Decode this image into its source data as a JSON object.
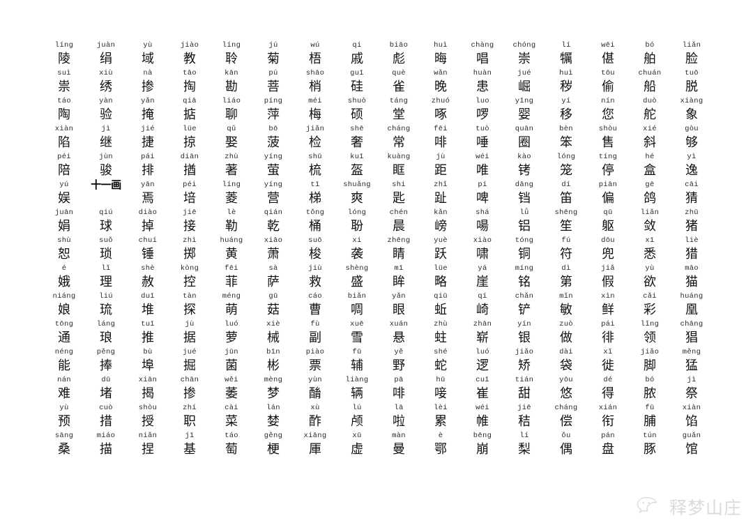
{
  "page": {
    "title": "汉字拼音表",
    "background_color": "#ffffff",
    "text_color": "#111111",
    "pinyin_color": "#2b2b2b"
  },
  "section_header": {
    "label": "十一画",
    "row_index": 6,
    "col_index": 1
  },
  "watermark": {
    "icon": "wechat-icon",
    "text": "释梦山庄",
    "color": "#b9b9b9"
  },
  "grid": {
    "columns": 16,
    "rows": 18,
    "cells": [
      [
        {
          "pinyin": "líng",
          "hanzi": "陵"
        },
        {
          "pinyin": "juàn",
          "hanzi": "绢"
        },
        {
          "pinyin": "yù",
          "hanzi": "域"
        },
        {
          "pinyin": "jiào",
          "hanzi": "教"
        },
        {
          "pinyin": "líng",
          "hanzi": "聆"
        },
        {
          "pinyin": "jú",
          "hanzi": "菊"
        },
        {
          "pinyin": "wú",
          "hanzi": "梧"
        },
        {
          "pinyin": "qi",
          "hanzi": "戚"
        },
        {
          "pinyin": "biāo",
          "hanzi": "彪"
        },
        {
          "pinyin": "huì",
          "hanzi": "晦"
        },
        {
          "pinyin": "chàng",
          "hanzi": "唱"
        },
        {
          "pinyin": "chóng",
          "hanzi": "崇"
        },
        {
          "pinyin": "lí",
          "hanzi": "犡"
        },
        {
          "pinyin": "wēi",
          "hanzi": "偡"
        },
        {
          "pinyin": "bó",
          "hanzi": "舶"
        },
        {
          "pinyin": "liǎn",
          "hanzi": "脸"
        }
      ],
      [
        {
          "pinyin": "suì",
          "hanzi": "祟"
        },
        {
          "pinyin": "xiù",
          "hanzi": "绣"
        },
        {
          "pinyin": "nà",
          "hanzi": "掺"
        },
        {
          "pinyin": "tāo",
          "hanzi": "掏"
        },
        {
          "pinyin": "kān",
          "hanzi": "勘"
        },
        {
          "pinyin": "pú",
          "hanzi": "菩"
        },
        {
          "pinyin": "shāo",
          "hanzi": "梢"
        },
        {
          "pinyin": "guī",
          "hanzi": "硅"
        },
        {
          "pinyin": "què",
          "hanzi": "雀"
        },
        {
          "pinyin": "wǎn",
          "hanzi": "晚"
        },
        {
          "pinyin": "huàn",
          "hanzi": "患"
        },
        {
          "pinyin": "jué",
          "hanzi": "崛"
        },
        {
          "pinyin": "huì",
          "hanzi": "秽"
        },
        {
          "pinyin": "tōu",
          "hanzi": "偷"
        },
        {
          "pinyin": "chuán",
          "hanzi": "船"
        },
        {
          "pinyin": "tuō",
          "hanzi": "脱"
        }
      ],
      [
        {
          "pinyin": "táo",
          "hanzi": "陶"
        },
        {
          "pinyin": "yàn",
          "hanzi": "验"
        },
        {
          "pinyin": "yǎn",
          "hanzi": "掩"
        },
        {
          "pinyin": "qiā",
          "hanzi": "掂"
        },
        {
          "pinyin": "liáo",
          "hanzi": "聊"
        },
        {
          "pinyin": "píng",
          "hanzi": "萍"
        },
        {
          "pinyin": "méi",
          "hanzi": "梅"
        },
        {
          "pinyin": "shuò",
          "hanzi": "硕"
        },
        {
          "pinyin": "táng",
          "hanzi": "堂"
        },
        {
          "pinyin": "zhuó",
          "hanzi": "啄"
        },
        {
          "pinyin": "luo",
          "hanzi": "啰"
        },
        {
          "pinyin": "yīng",
          "hanzi": "婴"
        },
        {
          "pinyin": "yí",
          "hanzi": "移"
        },
        {
          "pinyin": "nín",
          "hanzi": "您"
        },
        {
          "pinyin": "duò",
          "hanzi": "舵"
        },
        {
          "pinyin": "xiàng",
          "hanzi": "象"
        }
      ],
      [
        {
          "pinyin": "xiàn",
          "hanzi": "陷"
        },
        {
          "pinyin": "jì",
          "hanzi": "继"
        },
        {
          "pinyin": "jié",
          "hanzi": "捷"
        },
        {
          "pinyin": "lüe",
          "hanzi": "掠"
        },
        {
          "pinyin": "qǔ",
          "hanzi": "娶"
        },
        {
          "pinyin": "bō",
          "hanzi": "菠"
        },
        {
          "pinyin": "jiǎn",
          "hanzi": "检"
        },
        {
          "pinyin": "shē",
          "hanzi": "奢"
        },
        {
          "pinyin": "cháng",
          "hanzi": "常"
        },
        {
          "pinyin": "fēi",
          "hanzi": "啡"
        },
        {
          "pinyin": "tuò",
          "hanzi": "唾"
        },
        {
          "pinyin": "quān",
          "hanzi": "圈"
        },
        {
          "pinyin": "bèn",
          "hanzi": "笨"
        },
        {
          "pinyin": "shòu",
          "hanzi": "售"
        },
        {
          "pinyin": "xié",
          "hanzi": "斜"
        },
        {
          "pinyin": "gòu",
          "hanzi": "够"
        }
      ],
      [
        {
          "pinyin": "péi",
          "hanzi": "陪"
        },
        {
          "pinyin": "jùn",
          "hanzi": "骏"
        },
        {
          "pinyin": "pái",
          "hanzi": "排"
        },
        {
          "pinyin": "diān",
          "hanzi": "揂"
        },
        {
          "pinyin": "zhù",
          "hanzi": "著"
        },
        {
          "pinyin": "yíng",
          "hanzi": "萤"
        },
        {
          "pinyin": "shū",
          "hanzi": "梳"
        },
        {
          "pinyin": "kuī",
          "hanzi": "盔"
        },
        {
          "pinyin": "kuàng",
          "hanzi": "眶"
        },
        {
          "pinyin": "jù",
          "hanzi": "距"
        },
        {
          "pinyin": "wéi",
          "hanzi": "唯"
        },
        {
          "pinyin": "kào",
          "hanzi": "铐"
        },
        {
          "pinyin": "lóng",
          "hanzi": "笼"
        },
        {
          "pinyin": "tíng",
          "hanzi": "停"
        },
        {
          "pinyin": "hé",
          "hanzi": "盒"
        },
        {
          "pinyin": "yì",
          "hanzi": "逸"
        }
      ],
      [
        {
          "pinyin": "yú",
          "hanzi": "娱"
        },
        {
          "pinyin": "",
          "hanzi": "",
          "section": "十一画"
        },
        {
          "pinyin": "yān",
          "hanzi": "焉"
        },
        {
          "pinyin": "péi",
          "hanzi": "培"
        },
        {
          "pinyin": "líng",
          "hanzi": "菱"
        },
        {
          "pinyin": "yíng",
          "hanzi": "营"
        },
        {
          "pinyin": "tī",
          "hanzi": "梯"
        },
        {
          "pinyin": "shuǎng",
          "hanzi": "爽"
        },
        {
          "pinyin": "shi",
          "hanzi": "匙"
        },
        {
          "pinyin": "zhǐ",
          "hanzi": "趾"
        },
        {
          "pinyin": "pí",
          "hanzi": "啤"
        },
        {
          "pinyin": "dāng",
          "hanzi": "铛"
        },
        {
          "pinyin": "dí",
          "hanzi": "笛"
        },
        {
          "pinyin": "piān",
          "hanzi": "偏"
        },
        {
          "pinyin": "gē",
          "hanzi": "鸽"
        },
        {
          "pinyin": "cāi",
          "hanzi": "猜"
        }
      ],
      [
        {
          "pinyin": "juān",
          "hanzi": "娟"
        },
        {
          "pinyin": "qiú",
          "hanzi": "球"
        },
        {
          "pinyin": "diào",
          "hanzi": "掉"
        },
        {
          "pinyin": "jiē",
          "hanzi": "接"
        },
        {
          "pinyin": "lè",
          "hanzi": "勒"
        },
        {
          "pinyin": "qián",
          "hanzi": "乾"
        },
        {
          "pinyin": "tǒng",
          "hanzi": "桶"
        },
        {
          "pinyin": "lóng",
          "hanzi": "聁"
        },
        {
          "pinyin": "chén",
          "hanzi": "晨"
        },
        {
          "pinyin": "kǎn",
          "hanzi": "嵭"
        },
        {
          "pinyin": "shá",
          "hanzi": "啺"
        },
        {
          "pinyin": "lǚ",
          "hanzi": "铝"
        },
        {
          "pinyin": "shēng",
          "hanzi": "笙"
        },
        {
          "pinyin": "qū",
          "hanzi": "躯"
        },
        {
          "pinyin": "liǎn",
          "hanzi": "敛"
        },
        {
          "pinyin": "zhū",
          "hanzi": "猪"
        }
      ],
      [
        {
          "pinyin": "shù",
          "hanzi": "恕"
        },
        {
          "pinyin": "suǒ",
          "hanzi": "琐"
        },
        {
          "pinyin": "chuí",
          "hanzi": "锤"
        },
        {
          "pinyin": "zhì",
          "hanzi": "掷"
        },
        {
          "pinyin": "huáng",
          "hanzi": "黄"
        },
        {
          "pinyin": "xiāo",
          "hanzi": "萧"
        },
        {
          "pinyin": "suō",
          "hanzi": "梭"
        },
        {
          "pinyin": "xi",
          "hanzi": "袭"
        },
        {
          "pinyin": "zhēng",
          "hanzi": "睛"
        },
        {
          "pinyin": "yuè",
          "hanzi": "跃"
        },
        {
          "pinyin": "xiào",
          "hanzi": "啸"
        },
        {
          "pinyin": "tóng",
          "hanzi": "铜"
        },
        {
          "pinyin": "fú",
          "hanzi": "符"
        },
        {
          "pinyin": "dōu",
          "hanzi": "兜"
        },
        {
          "pinyin": "xī",
          "hanzi": "悉"
        },
        {
          "pinyin": "liè",
          "hanzi": "猎"
        }
      ],
      [
        {
          "pinyin": "é",
          "hanzi": "娥"
        },
        {
          "pinyin": "lǐ",
          "hanzi": "理"
        },
        {
          "pinyin": "shè",
          "hanzi": "赦"
        },
        {
          "pinyin": "kòng",
          "hanzi": "控"
        },
        {
          "pinyin": "fēi",
          "hanzi": "菲"
        },
        {
          "pinyin": "sà",
          "hanzi": "萨"
        },
        {
          "pinyin": "jiù",
          "hanzi": "救"
        },
        {
          "pinyin": "shèng",
          "hanzi": "盛"
        },
        {
          "pinyin": "mī",
          "hanzi": "眸"
        },
        {
          "pinyin": "lüe",
          "hanzi": "略"
        },
        {
          "pinyin": "yá",
          "hanzi": "崖"
        },
        {
          "pinyin": "míng",
          "hanzi": "铭"
        },
        {
          "pinyin": "dì",
          "hanzi": "第"
        },
        {
          "pinyin": "jiǎ",
          "hanzi": "假"
        },
        {
          "pinyin": "yù",
          "hanzi": "欲"
        },
        {
          "pinyin": "māo",
          "hanzi": "猫"
        }
      ],
      [
        {
          "pinyin": "niáng",
          "hanzi": "娘"
        },
        {
          "pinyin": "liú",
          "hanzi": "琉"
        },
        {
          "pinyin": "duī",
          "hanzi": "堆"
        },
        {
          "pinyin": "tàn",
          "hanzi": "探"
        },
        {
          "pinyin": "méng",
          "hanzi": "萌"
        },
        {
          "pinyin": "gū",
          "hanzi": "菇"
        },
        {
          "pinyin": "cáo",
          "hanzi": "曹"
        },
        {
          "pinyin": "biǎn",
          "hanzi": "啁"
        },
        {
          "pinyin": "yǎn",
          "hanzi": "眼"
        },
        {
          "pinyin": "qiū",
          "hanzi": "蚯"
        },
        {
          "pinyin": "qí",
          "hanzi": "崎"
        },
        {
          "pinyin": "chǎn",
          "hanzi": "铲"
        },
        {
          "pinyin": "mǐn",
          "hanzi": "敏"
        },
        {
          "pinyin": "xìn",
          "hanzi": "鲜"
        },
        {
          "pinyin": "cǎi",
          "hanzi": "彩"
        },
        {
          "pinyin": "huáng",
          "hanzi": "凰"
        }
      ],
      [
        {
          "pinyin": "tōng",
          "hanzi": "通"
        },
        {
          "pinyin": "láng",
          "hanzi": "琅"
        },
        {
          "pinyin": "tuī",
          "hanzi": "推"
        },
        {
          "pinyin": "jù",
          "hanzi": "据"
        },
        {
          "pinyin": "luó",
          "hanzi": "萝"
        },
        {
          "pinyin": "xiè",
          "hanzi": "械"
        },
        {
          "pinyin": "fù",
          "hanzi": "副"
        },
        {
          "pinyin": "xuē",
          "hanzi": "雪"
        },
        {
          "pinyin": "xuán",
          "hanzi": "悬"
        },
        {
          "pinyin": "zhù",
          "hanzi": "蛀"
        },
        {
          "pinyin": "zhān",
          "hanzi": "崭"
        },
        {
          "pinyin": "yín",
          "hanzi": "银"
        },
        {
          "pinyin": "zuò",
          "hanzi": "做"
        },
        {
          "pinyin": "pái",
          "hanzi": "徘"
        },
        {
          "pinyin": "lǐng",
          "hanzi": "领"
        },
        {
          "pinyin": "chāng",
          "hanzi": "猖"
        }
      ],
      [
        {
          "pinyin": "néng",
          "hanzi": "能"
        },
        {
          "pinyin": "pěng",
          "hanzi": "捧"
        },
        {
          "pinyin": "bù",
          "hanzi": "埠"
        },
        {
          "pinyin": "jué",
          "hanzi": "掘"
        },
        {
          "pinyin": "jūn",
          "hanzi": "菌"
        },
        {
          "pinyin": "bīn",
          "hanzi": "彬"
        },
        {
          "pinyin": "piào",
          "hanzi": "票"
        },
        {
          "pinyin": "fū",
          "hanzi": "辅"
        },
        {
          "pinyin": "yě",
          "hanzi": "野"
        },
        {
          "pinyin": "shé",
          "hanzi": "蛇"
        },
        {
          "pinyin": "luó",
          "hanzi": "逻"
        },
        {
          "pinyin": "jiǎo",
          "hanzi": "矫"
        },
        {
          "pinyin": "dài",
          "hanzi": "袋"
        },
        {
          "pinyin": "xǐ",
          "hanzi": "徙"
        },
        {
          "pinyin": "jiǎo",
          "hanzi": "脚"
        },
        {
          "pinyin": "měng",
          "hanzi": "猛"
        }
      ],
      [
        {
          "pinyin": "nán",
          "hanzi": "难"
        },
        {
          "pinyin": "dū",
          "hanzi": "堵"
        },
        {
          "pinyin": "xiān",
          "hanzi": "揭"
        },
        {
          "pinyin": "chān",
          "hanzi": "掺"
        },
        {
          "pinyin": "wěi",
          "hanzi": "萎"
        },
        {
          "pinyin": "mèng",
          "hanzi": "梦"
        },
        {
          "pinyin": "yùn",
          "hanzi": "酳"
        },
        {
          "pinyin": "liàng",
          "hanzi": "辆"
        },
        {
          "pinyin": "pā",
          "hanzi": "啡"
        },
        {
          "pinyin": "hū",
          "hanzi": "唼"
        },
        {
          "pinyin": "cuī",
          "hanzi": "崔"
        },
        {
          "pinyin": "tián",
          "hanzi": "甜"
        },
        {
          "pinyin": "yōu",
          "hanzi": "悠"
        },
        {
          "pinyin": "dé",
          "hanzi": "得"
        },
        {
          "pinyin": "bó",
          "hanzi": "脓"
        },
        {
          "pinyin": "jì",
          "hanzi": "祭"
        }
      ],
      [
        {
          "pinyin": "yù",
          "hanzi": "预"
        },
        {
          "pinyin": "cuò",
          "hanzi": "措"
        },
        {
          "pinyin": "shòu",
          "hanzi": "授"
        },
        {
          "pinyin": "zhí",
          "hanzi": "职"
        },
        {
          "pinyin": "cài",
          "hanzi": "菜"
        },
        {
          "pinyin": "lán",
          "hanzi": "婪"
        },
        {
          "pinyin": "xù",
          "hanzi": "酢"
        },
        {
          "pinyin": "lú",
          "hanzi": "颅"
        },
        {
          "pinyin": "lā",
          "hanzi": "啦"
        },
        {
          "pinyin": "lèi",
          "hanzi": "累"
        },
        {
          "pinyin": "wéi",
          "hanzi": "帷"
        },
        {
          "pinyin": "jiē",
          "hanzi": "秸"
        },
        {
          "pinyin": "cháng",
          "hanzi": "偿"
        },
        {
          "pinyin": "xián",
          "hanzi": "衔"
        },
        {
          "pinyin": "fū",
          "hanzi": "脯"
        },
        {
          "pinyin": "xiàn",
          "hanzi": "馅"
        }
      ],
      [
        {
          "pinyin": "sāng",
          "hanzi": "桑"
        },
        {
          "pinyin": "miáo",
          "hanzi": "描"
        },
        {
          "pinyin": "niǎn",
          "hanzi": "捏"
        },
        {
          "pinyin": "jī",
          "hanzi": "基"
        },
        {
          "pinyin": "táo",
          "hanzi": "萄"
        },
        {
          "pinyin": "gěng",
          "hanzi": "梗"
        },
        {
          "pinyin": "xiāng",
          "hanzi": "厙"
        },
        {
          "pinyin": "xū",
          "hanzi": "虚"
        },
        {
          "pinyin": "màn",
          "hanzi": "曼"
        },
        {
          "pinyin": "è",
          "hanzi": "鄂"
        },
        {
          "pinyin": "bēng",
          "hanzi": "崩"
        },
        {
          "pinyin": "lí",
          "hanzi": "梨"
        },
        {
          "pinyin": "ǒu",
          "hanzi": "偶"
        },
        {
          "pinyin": "pán",
          "hanzi": "盘"
        },
        {
          "pinyin": "tún",
          "hanzi": "豚"
        },
        {
          "pinyin": "guǎn",
          "hanzi": "馆"
        }
      ]
    ]
  }
}
